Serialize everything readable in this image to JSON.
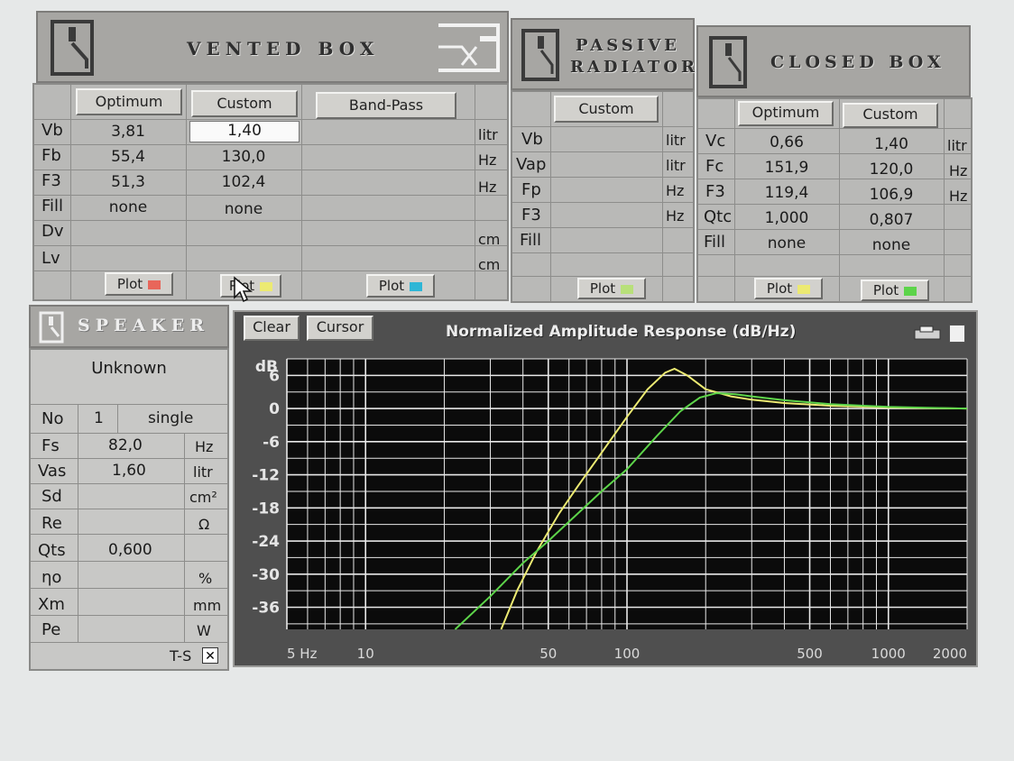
{
  "vented": {
    "title": "VENTED BOX",
    "buttons": {
      "optimum": "Optimum",
      "custom": "Custom",
      "bandpass": "Band-Pass"
    },
    "rows": [
      {
        "label": "Vb",
        "optimum": "3,81",
        "custom": "1,40",
        "unit": "litr"
      },
      {
        "label": "Fb",
        "optimum": "55,4",
        "custom": "130,0",
        "unit": "Hz"
      },
      {
        "label": "F3",
        "optimum": "51,3",
        "custom": "102,4",
        "unit": "Hz"
      },
      {
        "label": "Fill",
        "optimum": "none",
        "custom": "none",
        "unit": ""
      },
      {
        "label": "Dv",
        "optimum": "",
        "custom": "",
        "unit": "cm"
      },
      {
        "label": "Lv",
        "optimum": "",
        "custom": "",
        "unit": "cm"
      }
    ],
    "plot_label": "Plot",
    "plot_colors": {
      "optimum": "#e8665a",
      "custom": "#ecea72",
      "bandpass": "#2fb6d6"
    }
  },
  "passive": {
    "title_line1": "PASSIVE",
    "title_line2": "RADIATOR",
    "custom": "Custom",
    "rows": [
      {
        "label": "Vb",
        "unit": "litr"
      },
      {
        "label": "Vap",
        "unit": "litr"
      },
      {
        "label": "Fp",
        "unit": "Hz"
      },
      {
        "label": "F3",
        "unit": "Hz"
      },
      {
        "label": "Fill",
        "unit": ""
      }
    ],
    "plot_label": "Plot",
    "plot_color": "#b8e07a"
  },
  "closed": {
    "title": "CLOSED BOX",
    "buttons": {
      "optimum": "Optimum",
      "custom": "Custom"
    },
    "rows": [
      {
        "label": "Vc",
        "optimum": "0,66",
        "custom": "1,40",
        "unit": "litr"
      },
      {
        "label": "Fc",
        "optimum": "151,9",
        "custom": "120,0",
        "unit": "Hz"
      },
      {
        "label": "F3",
        "optimum": "119,4",
        "custom": "106,9",
        "unit": "Hz"
      },
      {
        "label": "Qtc",
        "optimum": "1,000",
        "custom": "0,807",
        "unit": ""
      },
      {
        "label": "Fill",
        "optimum": "none",
        "custom": "none",
        "unit": ""
      }
    ],
    "plot_label": "Plot",
    "plot_colors": {
      "optimum": "#ecea72",
      "custom": "#5dd44a"
    }
  },
  "speaker": {
    "title": "SPEAKER",
    "name": "Unknown",
    "no_label": "No",
    "no_value": "1",
    "no_mode": "single",
    "rows": [
      {
        "label": "Fs",
        "value": "82,0",
        "unit": "Hz"
      },
      {
        "label": "Vas",
        "value": "1,60",
        "unit": "litr"
      },
      {
        "label": "Sd",
        "value": "",
        "unit": "cm²"
      },
      {
        "label": "Re",
        "value": "",
        "unit": "Ω"
      },
      {
        "label": "Qts",
        "value": "0,600",
        "unit": ""
      },
      {
        "label": "ηo",
        "value": "",
        "unit": "%"
      },
      {
        "label": "Xm",
        "value": "",
        "unit": "mm"
      },
      {
        "label": "Pe",
        "value": "",
        "unit": "W"
      }
    ],
    "ts_label": "T-S",
    "ts_check": "✕"
  },
  "graph": {
    "clear": "Clear",
    "cursor": "Cursor",
    "title": "Normalized Amplitude Response (dB/Hz)"
  },
  "chart_data": {
    "type": "line",
    "title": "Normalized Amplitude Response (dB/Hz)",
    "xlabel": "",
    "ylabel": "dB",
    "xscale": "log",
    "xlim": [
      5,
      2000
    ],
    "ylim": [
      -40,
      9
    ],
    "yticks": [
      6,
      0,
      -6,
      -12,
      -18,
      -24,
      -30,
      -36
    ],
    "ytick_labels": [
      "6",
      "0",
      "-6",
      "-12",
      "-18",
      "-24",
      "-30",
      "-36"
    ],
    "xtick_labels": [
      {
        "v": 5,
        "t": "5 Hz"
      },
      {
        "v": 10,
        "t": "10"
      },
      {
        "v": 50,
        "t": "50"
      },
      {
        "v": 100,
        "t": "100"
      },
      {
        "v": 500,
        "t": "500"
      },
      {
        "v": 1000,
        "t": "1000"
      },
      {
        "v": 2000,
        "t": "2000"
      }
    ],
    "grid": true,
    "series": [
      {
        "color": "#ecea72",
        "x": [
          33,
          38,
          45,
          55,
          65,
          80,
          100,
          120,
          140,
          152,
          170,
          200,
          250,
          300,
          400,
          600,
          1000,
          2000
        ],
        "y": [
          -40,
          -33,
          -26,
          -19,
          -14,
          -8,
          -1.5,
          3.5,
          6.5,
          7.2,
          6.0,
          3.5,
          2.2,
          1.6,
          1.0,
          0.5,
          0.2,
          0.0
        ]
      },
      {
        "color": "#5dd44a",
        "x": [
          22,
          30,
          40,
          50,
          60,
          80,
          100,
          130,
          160,
          190,
          220,
          260,
          300,
          400,
          600,
          1000,
          2000
        ],
        "y": [
          -40,
          -34,
          -28,
          -24,
          -20.5,
          -15,
          -11,
          -5,
          -0.5,
          2.0,
          2.8,
          2.6,
          2.2,
          1.5,
          0.8,
          0.3,
          0.0
        ]
      }
    ]
  }
}
